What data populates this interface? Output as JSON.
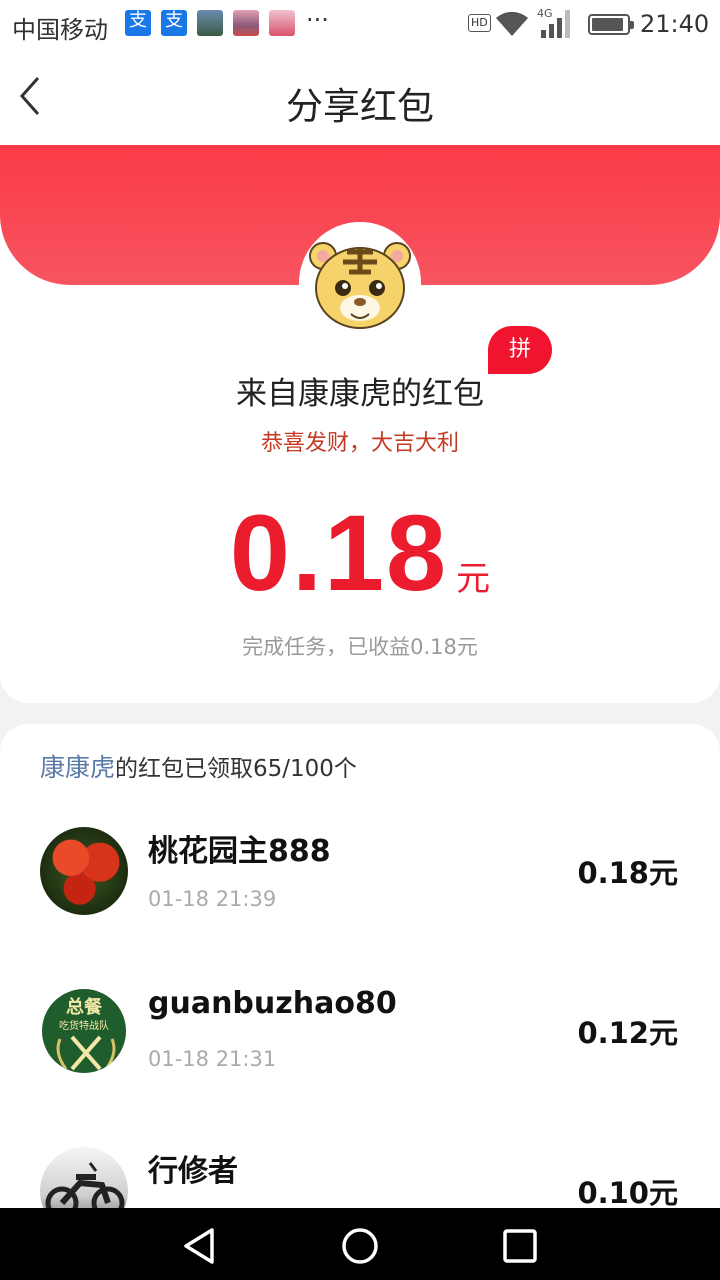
{
  "status_bar": {
    "carrier": "中国移动",
    "notif_glyph": "支",
    "more": "···",
    "hd": "HD",
    "network": "4G",
    "time": "21:40"
  },
  "nav": {
    "title": "分享红包",
    "back_icon": "chevron-left-icon"
  },
  "packet": {
    "badge": "拼",
    "from": "来自康康虎的红包",
    "blessing": "恭喜发财，大吉大利",
    "amount": "0.18",
    "unit": "元",
    "task_text": "完成任务，已收益0.18元"
  },
  "claims": {
    "owner": "康康虎",
    "summary": "的红包已领取65/100个",
    "items": [
      {
        "name": "桃花园主888",
        "time": "01-18 21:39",
        "amount": "0.18元"
      },
      {
        "name": "guanbuzhao80",
        "time": "01-18 21:31",
        "amount": "0.12元",
        "avatar_text_1": "总餐",
        "avatar_text_2": "吃货特战队"
      },
      {
        "name": "行修者",
        "time": "",
        "amount": "0.10元"
      }
    ]
  },
  "colors": {
    "banner_red": "#fb3a47",
    "amount_red": "#ec1c2f",
    "owner_blue": "#5a7aa8"
  }
}
